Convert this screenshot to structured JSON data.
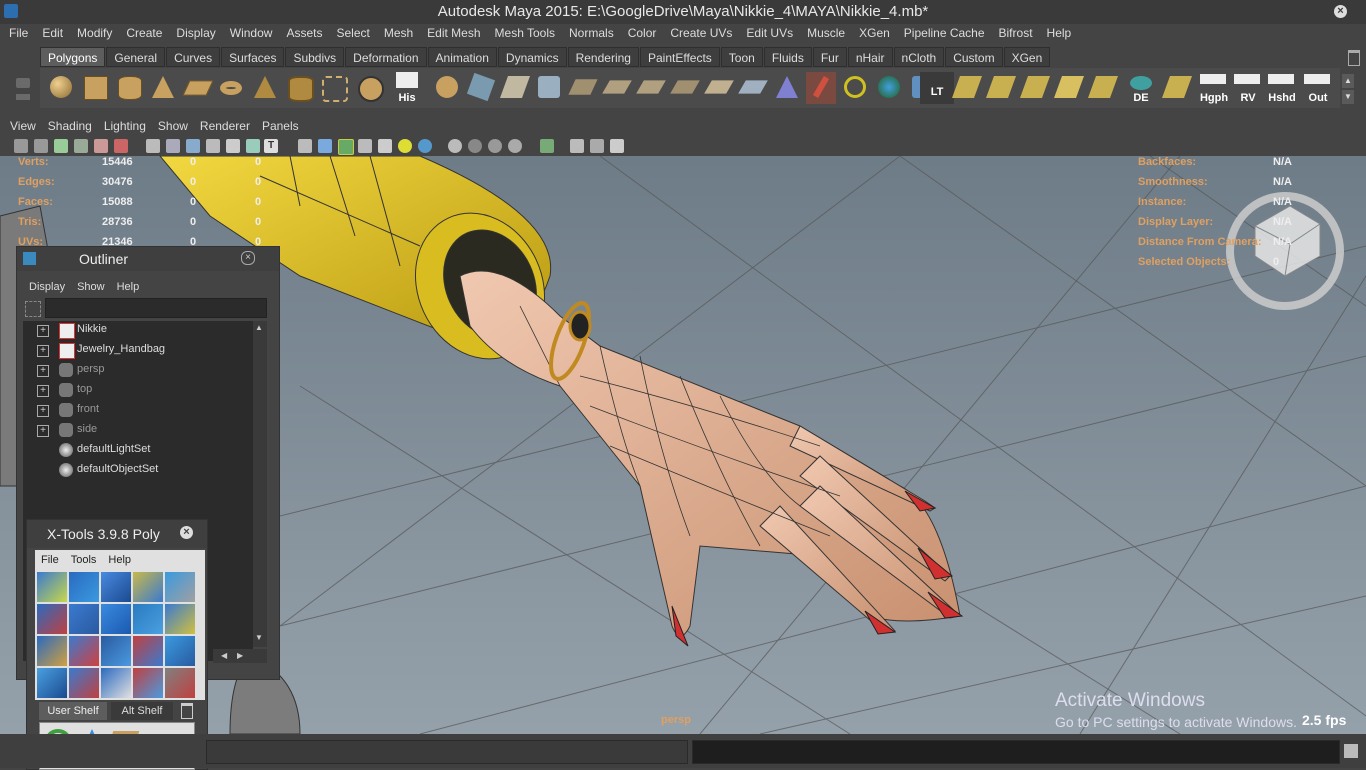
{
  "window": {
    "title": "Autodesk Maya 2015: E:\\GoogleDrive\\Maya\\Nikkie_4\\MAYA\\Nikkie_4.mb*"
  },
  "main_menu": [
    "File",
    "Edit",
    "Modify",
    "Create",
    "Display",
    "Window",
    "Assets",
    "Select",
    "Mesh",
    "Edit Mesh",
    "Mesh Tools",
    "Normals",
    "Color",
    "Create UVs",
    "Edit UVs",
    "Muscle",
    "XGen",
    "Pipeline Cache",
    "Bifrost",
    "Help"
  ],
  "shelf_tabs": [
    "Polygons",
    "General",
    "Curves",
    "Surfaces",
    "Subdivs",
    "Deformation",
    "Animation",
    "Dynamics",
    "Rendering",
    "PaintEffects",
    "Toon",
    "Fluids",
    "Fur",
    "nHair",
    "nCloth",
    "Custom",
    "XGen"
  ],
  "shelf_active_tab": "Polygons",
  "shelf_labels": {
    "his": "His",
    "lt": "LT",
    "de": "DE",
    "hgph": "Hgph",
    "rv": "RV",
    "hshd": "Hshd",
    "out": "Out"
  },
  "panel_menu": [
    "View",
    "Shading",
    "Lighting",
    "Show",
    "Renderer",
    "Panels"
  ],
  "hud_left": [
    {
      "label": "Verts:",
      "v1": "15446",
      "v2": "0",
      "v3": "0"
    },
    {
      "label": "Edges:",
      "v1": "30476",
      "v2": "0",
      "v3": "0"
    },
    {
      "label": "Faces:",
      "v1": "15088",
      "v2": "0",
      "v3": "0"
    },
    {
      "label": "Tris:",
      "v1": "28736",
      "v2": "0",
      "v3": "0"
    },
    {
      "label": "UVs:",
      "v1": "21346",
      "v2": "0",
      "v3": "0"
    }
  ],
  "hud_right": [
    {
      "label": "Backfaces:",
      "value": "N/A"
    },
    {
      "label": "Smoothness:",
      "value": "N/A"
    },
    {
      "label": "Instance:",
      "value": "N/A"
    },
    {
      "label": "Display Layer:",
      "value": "N/A"
    },
    {
      "label": "Distance From Camera:",
      "value": "N/A"
    },
    {
      "label": "Selected Objects:",
      "value": "0"
    }
  ],
  "viewport": {
    "camera_label": "persp",
    "fps": "2.5 fps",
    "activate_title": "Activate Windows",
    "activate_sub": "Go to PC settings to activate Windows."
  },
  "outliner": {
    "title": "Outliner",
    "menu": [
      "Display",
      "Show",
      "Help"
    ],
    "items": [
      {
        "name": "Nikkie",
        "icon": "mesh-group",
        "dim": false
      },
      {
        "name": "Jewelry_Handbag",
        "icon": "mesh-group",
        "dim": false
      },
      {
        "name": "persp",
        "icon": "camera",
        "dim": true
      },
      {
        "name": "top",
        "icon": "camera",
        "dim": true
      },
      {
        "name": "front",
        "icon": "camera",
        "dim": true
      },
      {
        "name": "side",
        "icon": "camera",
        "dim": true
      },
      {
        "name": "defaultLightSet",
        "icon": "set",
        "dim": false
      },
      {
        "name": "defaultObjectSet",
        "icon": "set",
        "dim": false
      }
    ]
  },
  "xtools": {
    "title": "X-Tools 3.9.8 Poly",
    "menu": [
      "File",
      "Tools",
      "Help"
    ],
    "tabs": [
      "User Shelf",
      "Alt Shelf"
    ]
  },
  "colors": {
    "accent_tab": "#5d5d5d",
    "hud_label": "#e0a060",
    "viewport_bg": "#7f8b96",
    "sleeve": "#e0c020",
    "skin": "#d9a58c",
    "nail": "#d03030"
  }
}
